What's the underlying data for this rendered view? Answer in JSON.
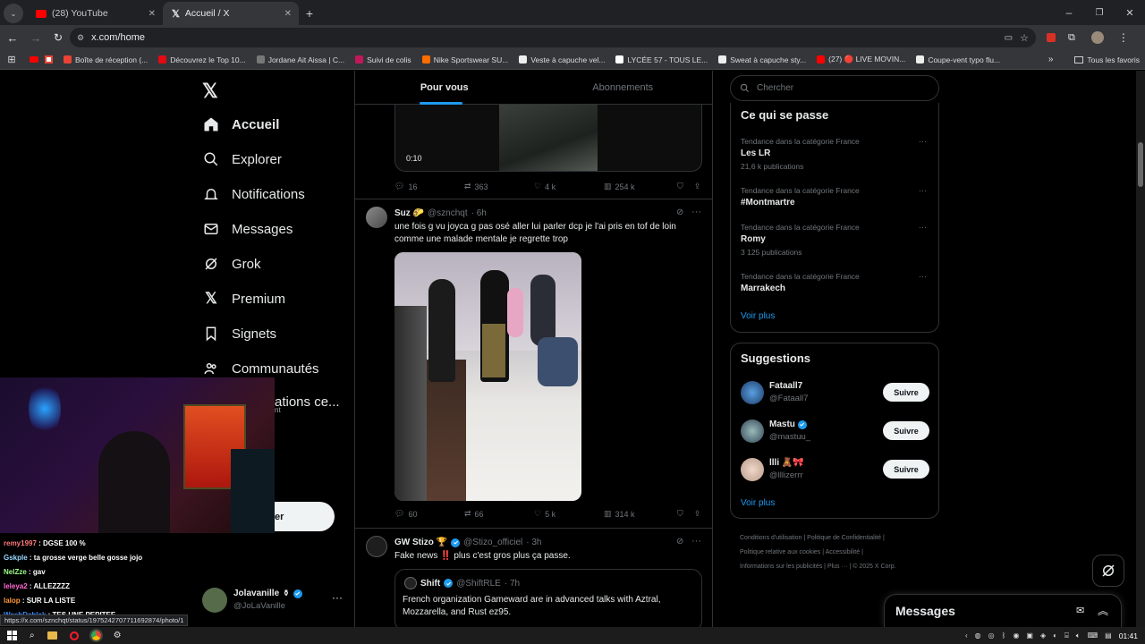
{
  "browser": {
    "tabs": [
      {
        "title": "(28) YouTube"
      },
      {
        "title": "Accueil / X"
      }
    ],
    "url": "x.com/home",
    "bookmarks": [
      "Boîte de réception (...",
      "Découvrez le Top 10...",
      "Jordane Ait Aissa | C...",
      "Suivi de colis",
      "Nike Sportswear SU...",
      "Veste à capuche vel...",
      "LYCÉE 57 - TOUS LE...",
      "Sweat à capuche sty...",
      "(27) 🔴 LIVE MOVIN...",
      "Coupe-vent typo flu..."
    ],
    "all_bookmarks": "Tous les favoris",
    "status_url": "https://x.com/sznchqt/status/1975242707711692874/photo/1"
  },
  "nav": {
    "items": [
      "Accueil",
      "Explorer",
      "Notifications",
      "Messages",
      "Grok",
      "Premium",
      "Signets",
      "Communautés"
    ],
    "partial_item": "ations ce...",
    "partial_sub": "nt",
    "post_button_partial": "er",
    "account": {
      "name": "Jolavanille",
      "handle": "@JoLaVanille"
    }
  },
  "timeline": {
    "tabs": [
      "Pour vous",
      "Abonnements"
    ],
    "prev_tweet": {
      "video_time": "0:10",
      "stats": {
        "replies": "16",
        "reposts": "363",
        "likes": "4 k",
        "views": "254 k"
      }
    },
    "tweet1": {
      "name": "Suz 🌮",
      "handle": "@sznchqt",
      "time": "· 6h",
      "text": "une fois g vu joyca g pas osé aller lui parler dcp je l'ai pris en tof de loin comme une malade mentale je regrette trop",
      "stats": {
        "replies": "60",
        "reposts": "66",
        "likes": "5 k",
        "views": "314 k"
      }
    },
    "tweet2": {
      "name": "GW Stizo 🏆",
      "handle": "@Stizo_officiel",
      "time": "· 3h",
      "text": "Fake news ‼️ plus c'est gros plus ça passe.",
      "quote": {
        "name": "Shift",
        "handle": "@ShiftRLE",
        "time": "· 7h",
        "text": "French organization Gameward are in advanced talks with Aztral, Mozzarella, and Rust ez95."
      }
    }
  },
  "sidebar": {
    "search_placeholder": "Chercher",
    "trends_title": "Ce qui se passe",
    "trends": [
      {
        "category": "Tendance dans la catégorie France",
        "name": "Les LR",
        "count": "21,6 k publications"
      },
      {
        "category": "Tendance dans la catégorie France",
        "name": "#Montmartre",
        "count": ""
      },
      {
        "category": "Tendance dans la catégorie France",
        "name": "Romy",
        "count": "3 125 publications"
      },
      {
        "category": "Tendance dans la catégorie France",
        "name": "Marrakech",
        "count": ""
      }
    ],
    "see_more": "Voir plus",
    "suggestions_title": "Suggestions",
    "suggestions": [
      {
        "name": "Fataall7",
        "handle": "@Fataall7",
        "button": "Suivre"
      },
      {
        "name": "Mastu",
        "handle": "@mastuu_",
        "button": "Suivre"
      },
      {
        "name": "llli 🧸🎀",
        "handle": "@lllizerrr",
        "button": "Suivre"
      }
    ],
    "footer": [
      "Conditions d'utilisation",
      "Politique de Confidentialité",
      "Politique relative aux cookies",
      "Accessibilité",
      "Informations sur les publicités",
      "Plus ···",
      "© 2025 X Corp."
    ],
    "messages_drawer": "Messages"
  },
  "chat": [
    {
      "user": "remy1997",
      "msg": "DGSE 100 %",
      "color": "#ff7a7a"
    },
    {
      "user": "Gskple",
      "msg": "ta grosse verge belle gosse jojo",
      "color": "#9ad8ff"
    },
    {
      "user": "NelZze",
      "msg": "gav",
      "color": "#9dff8a"
    },
    {
      "user": "leleya2",
      "msg": "ALLEZZZZ",
      "color": "#ff6ad5"
    },
    {
      "user": "lalop",
      "msg": "SUR LA LISTE",
      "color": "#ff9a3c"
    },
    {
      "user": "WeshDahlek",
      "msg": "TES UNE PEPITEE",
      "color": "#3c8cff"
    }
  ],
  "taskbar": {
    "time": "01:41"
  }
}
